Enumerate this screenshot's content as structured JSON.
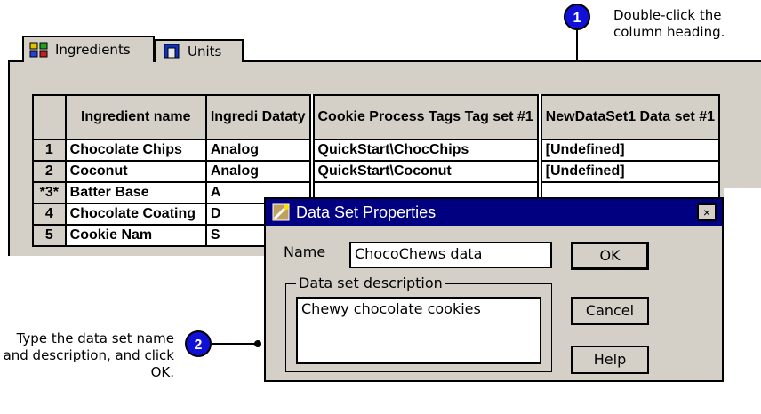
{
  "notes": {
    "step1_number": "1",
    "step1_text": "Double-click the column heading.",
    "step2_number": "2",
    "step2_text": "Type the data set name and description, and click OK."
  },
  "tabs": [
    {
      "label": "Ingredients",
      "icon": "ingredients-icon"
    },
    {
      "label": "Units",
      "icon": "units-icon"
    }
  ],
  "grid": {
    "headers": [
      "",
      "Ingredient name",
      "Ingredi Dataty",
      "Cookie Process Tags Tag set #1",
      "NewDataSet1 Data set #1"
    ],
    "rows": [
      {
        "num": "1",
        "name": "Chocolate Chips",
        "type": "Analog",
        "tag": "QuickStart\\ChocChips",
        "data": "[Undefined]"
      },
      {
        "num": "2",
        "name": "Coconut",
        "type": "Analog",
        "tag": "QuickStart\\Coconut",
        "data": "[Undefined]"
      },
      {
        "num": "*3*",
        "name": "Batter Base",
        "type": "A",
        "tag": "",
        "data": ""
      },
      {
        "num": "4",
        "name": "Chocolate Coating",
        "type": "D",
        "tag": "",
        "data": ""
      },
      {
        "num": "5",
        "name": "Cookie Nam",
        "type": "S",
        "tag": "",
        "data": ""
      }
    ]
  },
  "dialog": {
    "title": "Data Set Properties",
    "close": "×",
    "name_label": "Name",
    "name_value": "ChocoChews data",
    "desc_group_label": "Data set description",
    "desc_value": "Chewy chocolate cookies",
    "ok": "OK",
    "cancel": "Cancel",
    "help": "Help"
  }
}
